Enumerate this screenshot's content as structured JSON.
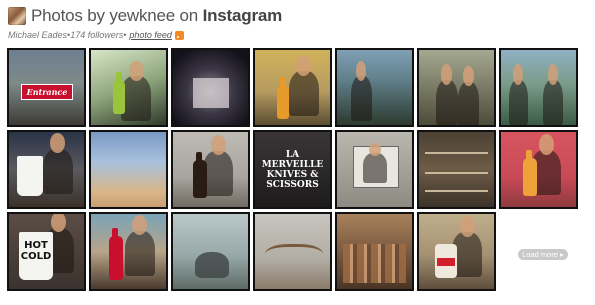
{
  "header": {
    "title_prefix": "Photos by yewknee on ",
    "title_brand": "Instagram"
  },
  "subline": {
    "name": "Michael Eades",
    "separator1": " • ",
    "followers": "174 followers",
    "separator2": " • ",
    "photo_feed_link": "photo feed",
    "feed_icon": "rss-icon"
  },
  "photos": [
    {
      "desc": "Entrance sign",
      "text": "Entrance"
    },
    {
      "desc": "man holding Jarritos bottle",
      "text": ""
    },
    {
      "desc": "white building at night",
      "text": ""
    },
    {
      "desc": "man holding orange bottle",
      "text": ""
    },
    {
      "desc": "man standing in yard",
      "text": ""
    },
    {
      "desc": "people on porch",
      "text": ""
    },
    {
      "desc": "people in jeep",
      "text": ""
    },
    {
      "desc": "man with white cup",
      "text": ""
    },
    {
      "desc": "cloudy sky",
      "text": ""
    },
    {
      "desc": "man holding beer bottle",
      "text": ""
    },
    {
      "desc": "Knives & Scissors sign",
      "text": "LA MERVEILLE KNIVES & SCISSORS"
    },
    {
      "desc": "man in frame",
      "text": ""
    },
    {
      "desc": "bookshelf",
      "text": ""
    },
    {
      "desc": "man holding soda bottle",
      "text": ""
    },
    {
      "desc": "man with Hot Cold cup",
      "text": "HOT COLD"
    },
    {
      "desc": "man with Coca-Cola bottle",
      "text": ""
    },
    {
      "desc": "cat near window",
      "text": ""
    },
    {
      "desc": "antlers on table",
      "text": ""
    },
    {
      "desc": "rows of cowboy boots",
      "text": ""
    },
    {
      "desc": "man with milk jug",
      "text": ""
    }
  ],
  "load_more_label": "Load more ▸"
}
